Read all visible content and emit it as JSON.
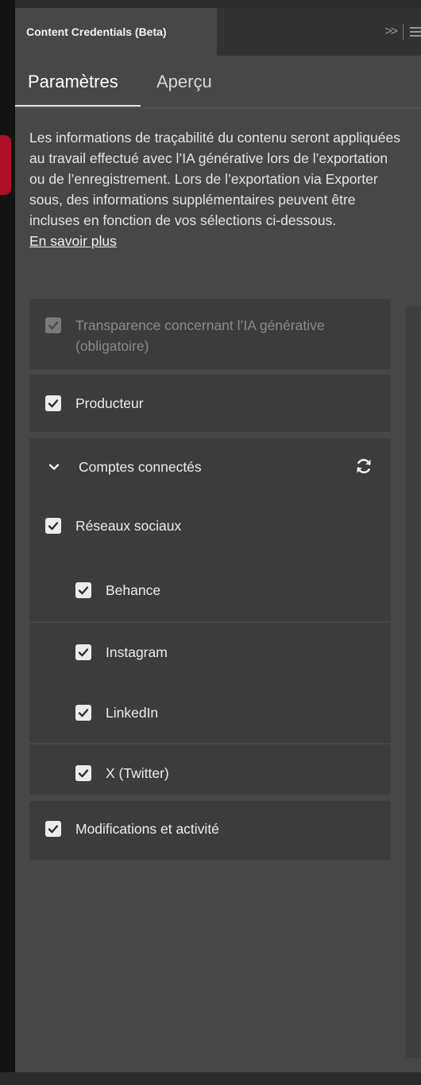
{
  "header": {
    "panel_title": "Content Credentials (Beta)",
    "collapse_icon": "double-chevron-right-icon",
    "menu_icon": "hamburger-menu-icon"
  },
  "tabs": [
    {
      "label": "Paramètres",
      "selected": true
    },
    {
      "label": "Aperçu",
      "selected": false
    }
  ],
  "description": {
    "text": "Les informations de traçabilité du contenu seront appliquées au travail effectué avec l’IA générative lors de l’exportation ou de l’enregistrement. Lors de l’exportation via Exporter sous, des informations supplémentaires peuvent être incluses en fonction de vos sélections ci-dessous.",
    "link_label": "En savoir plus"
  },
  "options": {
    "genai": {
      "label": "Transparence concernant l’IA générative (obligatoire)",
      "checked": true,
      "disabled": true
    },
    "producer": {
      "label": "Producteur",
      "checked": true
    },
    "connected_accounts": {
      "label": "Comptes connectés",
      "expanded": true,
      "refresh_icon": "refresh-icon",
      "social": {
        "label": "Réseaux sociaux",
        "checked": true
      },
      "accounts": [
        {
          "label": "Behance",
          "checked": true
        },
        {
          "label": "Instagram",
          "checked": true
        },
        {
          "label": "LinkedIn",
          "checked": true
        },
        {
          "label": "X (Twitter)",
          "checked": true
        }
      ]
    },
    "edits": {
      "label": "Modifications et activité",
      "checked": true
    }
  },
  "colors": {
    "panel_bg": "#474747",
    "card_bg": "#3c3c3c",
    "header_bg": "#323232",
    "text": "#ececec",
    "checkbox": "#ececec"
  }
}
